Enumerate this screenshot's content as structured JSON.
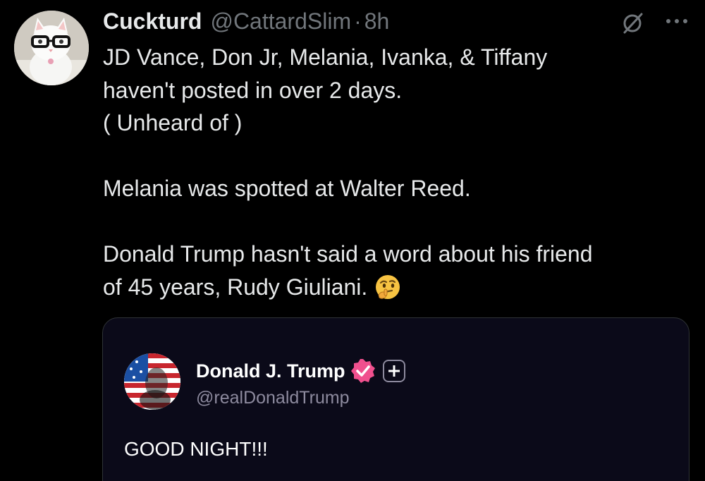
{
  "post": {
    "author": {
      "display_name": "Cuckturd",
      "handle": "@CattardSlim",
      "separator": "·",
      "time": "8h",
      "avatar_icon": "cat-with-glasses-avatar"
    },
    "actions": {
      "grok_icon": "slashed-circle-icon",
      "more_icon": "more-dots-icon"
    },
    "text_lines": [
      "JD Vance, Don Jr, Melania, Ivanka, & Tiffany",
      "haven't posted in over 2 days.",
      "( Unheard of )",
      "Melania was spotted at Walter Reed.",
      "Donald Trump hasn't said a word about his friend",
      "of 45 years, Rudy Giuliani."
    ],
    "emoji": "thinking-face-emoji",
    "quote": {
      "display_name": "Donald J. Trump",
      "handle": "@realDonaldTrump",
      "text": "GOOD NIGHT!!!",
      "verified_color": "#f0508e",
      "avatar_icon": "flag-face-avatar",
      "plus_icon": "plus-badge-icon"
    }
  },
  "colors": {
    "background": "#000000",
    "text": "#e7e9ea",
    "muted": "#71767b",
    "quote_background": "#0b0a19",
    "border": "#2f3336"
  }
}
